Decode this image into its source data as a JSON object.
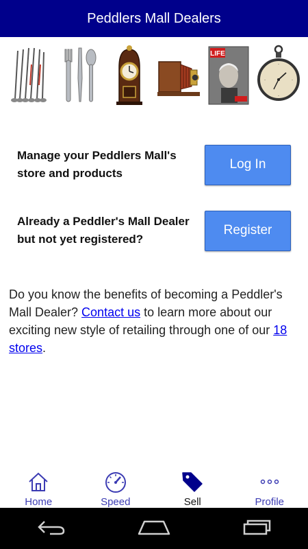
{
  "header": {
    "title": "Peddlers Mall Dealers"
  },
  "banner": {
    "items": [
      {
        "icon": "golf-clubs-image"
      },
      {
        "icon": "silverware-image"
      },
      {
        "icon": "mantel-clock-image"
      },
      {
        "icon": "antique-camera-image"
      },
      {
        "icon": "life-magazine-image",
        "text": "LIFE"
      },
      {
        "icon": "pocket-watch-image"
      }
    ]
  },
  "login_row": {
    "text": "Manage your Peddlers Mall's store and products",
    "button": "Log In"
  },
  "register_row": {
    "text": "Already a Peddler's Mall Dealer but not yet registered?",
    "button": "Register"
  },
  "info": {
    "text_before": "Do you know the benefits of becoming a Peddler's Mall Dealer? ",
    "contact_link": "Contact us",
    "text_middle": " to learn more about our exciting new style of retailing through one of our ",
    "stores_link": "18 stores",
    "text_after": "."
  },
  "tabbar": {
    "tabs": [
      {
        "label": "Home",
        "icon": "home-icon"
      },
      {
        "label": "Speed",
        "icon": "speedometer-icon"
      },
      {
        "label": "Sell",
        "icon": "tag-icon",
        "active": true
      },
      {
        "label": "Profile",
        "icon": "more-dots-icon"
      }
    ]
  },
  "colors": {
    "header_bg": "#00008b",
    "button_bg": "#4e8bf0",
    "tab_text": "#3b3bb3",
    "link": "#0000ee"
  }
}
